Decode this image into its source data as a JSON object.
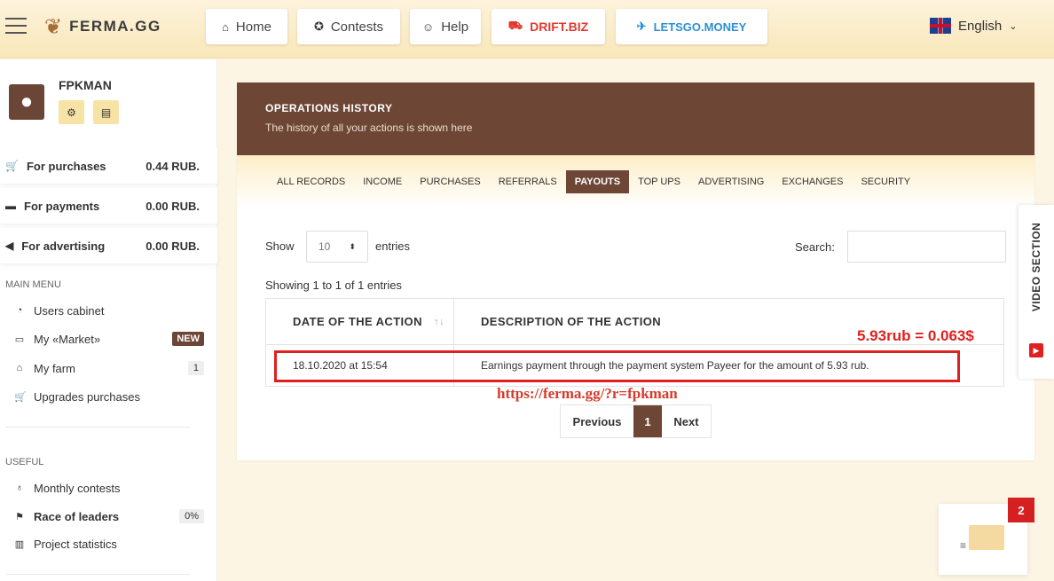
{
  "header": {
    "logo": "FERMA.GG",
    "nav": [
      {
        "label": "Home",
        "icon": "home-icon"
      },
      {
        "label": "Contests",
        "icon": "medal-icon"
      },
      {
        "label": "Help",
        "icon": "support-icon"
      },
      {
        "label": "DRIFT.BIZ",
        "icon": "car-icon"
      },
      {
        "label": "LETSGO.MONEY",
        "icon": "plane-icon"
      }
    ],
    "language": "English"
  },
  "sidebar": {
    "username": "FPKMAN",
    "balances": [
      {
        "label": "For purchases",
        "value": "0.44 RUB.",
        "icon": "cart-icon"
      },
      {
        "label": "For payments",
        "value": "0.00 RUB.",
        "icon": "wallet-icon"
      },
      {
        "label": "For advertising",
        "value": "0.00 RUB.",
        "icon": "megaphone-icon"
      }
    ],
    "main_menu_title": "MAIN MENU",
    "main_menu": [
      {
        "label": "Users cabinet",
        "icon": "dashboard-icon",
        "badge": ""
      },
      {
        "label": "My «Market»",
        "icon": "store-icon",
        "badge": "NEW"
      },
      {
        "label": "My farm",
        "icon": "farm-icon",
        "badge": "1"
      },
      {
        "label": "Upgrades purchases",
        "icon": "cart-icon",
        "badge": ""
      }
    ],
    "useful_title": "USEFUL",
    "useful_menu": [
      {
        "label": "Monthly contests",
        "icon": "award-icon",
        "badge": ""
      },
      {
        "label": "Race of leaders",
        "icon": "flag-icon",
        "badge": "0%"
      },
      {
        "label": "Project statistics",
        "icon": "chart-icon",
        "badge": ""
      }
    ]
  },
  "main": {
    "title": "OPERATIONS HISTORY",
    "subtitle": "The history of all your actions is shown here",
    "tabs": [
      "ALL RECORDS",
      "INCOME",
      "PURCHASES",
      "REFERRALS",
      "PAYOUTS",
      "TOP UPS",
      "ADVERTISING",
      "EXCHANGES",
      "SECURITY"
    ],
    "active_tab": "PAYOUTS",
    "show_label": "Show",
    "page_size": "10",
    "entries_label": "entries",
    "search_label": "Search:",
    "search_value": "",
    "showing": "Showing 1 to 1 of 1 entries",
    "columns": [
      "DATE OF THE ACTION",
      "DESCRIPTION OF THE ACTION"
    ],
    "rows": [
      {
        "date": "18.10.2020 at 15:54",
        "description": "Earnings payment through the payment system Payeer for the amount of 5.93 rub."
      }
    ],
    "pager": {
      "prev": "Previous",
      "current": "1",
      "next": "Next"
    }
  },
  "annotations": {
    "rate": "5.93rub = 0.063$",
    "link": "https://ferma.gg/?r=fpkman",
    "color": "#e0201f"
  },
  "video_section": "VIDEO SECTION",
  "mail_badge": "2",
  "colors": {
    "brand_brown": "#6d4636",
    "accent_yellow": "#f8e3a7",
    "drift_red": "#e03b2e",
    "letsgo_blue": "#2c8fd6"
  }
}
